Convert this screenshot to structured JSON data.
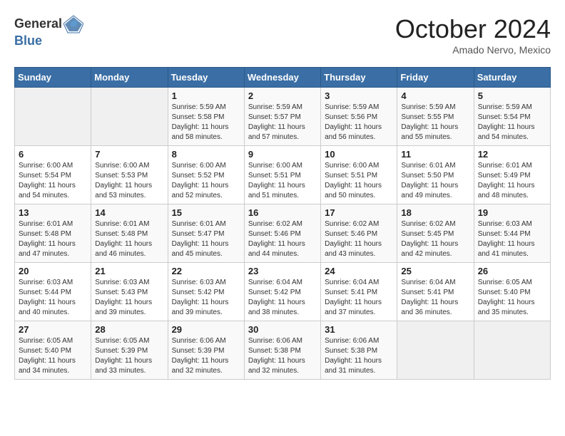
{
  "logo": {
    "general": "General",
    "blue": "Blue"
  },
  "title": "October 2024",
  "location": "Amado Nervo, Mexico",
  "days_of_week": [
    "Sunday",
    "Monday",
    "Tuesday",
    "Wednesday",
    "Thursday",
    "Friday",
    "Saturday"
  ],
  "weeks": [
    [
      {
        "day": "",
        "info": ""
      },
      {
        "day": "",
        "info": ""
      },
      {
        "day": "1",
        "info": "Sunrise: 5:59 AM\nSunset: 5:58 PM\nDaylight: 11 hours and 58 minutes."
      },
      {
        "day": "2",
        "info": "Sunrise: 5:59 AM\nSunset: 5:57 PM\nDaylight: 11 hours and 57 minutes."
      },
      {
        "day": "3",
        "info": "Sunrise: 5:59 AM\nSunset: 5:56 PM\nDaylight: 11 hours and 56 minutes."
      },
      {
        "day": "4",
        "info": "Sunrise: 5:59 AM\nSunset: 5:55 PM\nDaylight: 11 hours and 55 minutes."
      },
      {
        "day": "5",
        "info": "Sunrise: 5:59 AM\nSunset: 5:54 PM\nDaylight: 11 hours and 54 minutes."
      }
    ],
    [
      {
        "day": "6",
        "info": "Sunrise: 6:00 AM\nSunset: 5:54 PM\nDaylight: 11 hours and 54 minutes."
      },
      {
        "day": "7",
        "info": "Sunrise: 6:00 AM\nSunset: 5:53 PM\nDaylight: 11 hours and 53 minutes."
      },
      {
        "day": "8",
        "info": "Sunrise: 6:00 AM\nSunset: 5:52 PM\nDaylight: 11 hours and 52 minutes."
      },
      {
        "day": "9",
        "info": "Sunrise: 6:00 AM\nSunset: 5:51 PM\nDaylight: 11 hours and 51 minutes."
      },
      {
        "day": "10",
        "info": "Sunrise: 6:00 AM\nSunset: 5:51 PM\nDaylight: 11 hours and 50 minutes."
      },
      {
        "day": "11",
        "info": "Sunrise: 6:01 AM\nSunset: 5:50 PM\nDaylight: 11 hours and 49 minutes."
      },
      {
        "day": "12",
        "info": "Sunrise: 6:01 AM\nSunset: 5:49 PM\nDaylight: 11 hours and 48 minutes."
      }
    ],
    [
      {
        "day": "13",
        "info": "Sunrise: 6:01 AM\nSunset: 5:48 PM\nDaylight: 11 hours and 47 minutes."
      },
      {
        "day": "14",
        "info": "Sunrise: 6:01 AM\nSunset: 5:48 PM\nDaylight: 11 hours and 46 minutes."
      },
      {
        "day": "15",
        "info": "Sunrise: 6:01 AM\nSunset: 5:47 PM\nDaylight: 11 hours and 45 minutes."
      },
      {
        "day": "16",
        "info": "Sunrise: 6:02 AM\nSunset: 5:46 PM\nDaylight: 11 hours and 44 minutes."
      },
      {
        "day": "17",
        "info": "Sunrise: 6:02 AM\nSunset: 5:46 PM\nDaylight: 11 hours and 43 minutes."
      },
      {
        "day": "18",
        "info": "Sunrise: 6:02 AM\nSunset: 5:45 PM\nDaylight: 11 hours and 42 minutes."
      },
      {
        "day": "19",
        "info": "Sunrise: 6:03 AM\nSunset: 5:44 PM\nDaylight: 11 hours and 41 minutes."
      }
    ],
    [
      {
        "day": "20",
        "info": "Sunrise: 6:03 AM\nSunset: 5:44 PM\nDaylight: 11 hours and 40 minutes."
      },
      {
        "day": "21",
        "info": "Sunrise: 6:03 AM\nSunset: 5:43 PM\nDaylight: 11 hours and 39 minutes."
      },
      {
        "day": "22",
        "info": "Sunrise: 6:03 AM\nSunset: 5:42 PM\nDaylight: 11 hours and 39 minutes."
      },
      {
        "day": "23",
        "info": "Sunrise: 6:04 AM\nSunset: 5:42 PM\nDaylight: 11 hours and 38 minutes."
      },
      {
        "day": "24",
        "info": "Sunrise: 6:04 AM\nSunset: 5:41 PM\nDaylight: 11 hours and 37 minutes."
      },
      {
        "day": "25",
        "info": "Sunrise: 6:04 AM\nSunset: 5:41 PM\nDaylight: 11 hours and 36 minutes."
      },
      {
        "day": "26",
        "info": "Sunrise: 6:05 AM\nSunset: 5:40 PM\nDaylight: 11 hours and 35 minutes."
      }
    ],
    [
      {
        "day": "27",
        "info": "Sunrise: 6:05 AM\nSunset: 5:40 PM\nDaylight: 11 hours and 34 minutes."
      },
      {
        "day": "28",
        "info": "Sunrise: 6:05 AM\nSunset: 5:39 PM\nDaylight: 11 hours and 33 minutes."
      },
      {
        "day": "29",
        "info": "Sunrise: 6:06 AM\nSunset: 5:39 PM\nDaylight: 11 hours and 32 minutes."
      },
      {
        "day": "30",
        "info": "Sunrise: 6:06 AM\nSunset: 5:38 PM\nDaylight: 11 hours and 32 minutes."
      },
      {
        "day": "31",
        "info": "Sunrise: 6:06 AM\nSunset: 5:38 PM\nDaylight: 11 hours and 31 minutes."
      },
      {
        "day": "",
        "info": ""
      },
      {
        "day": "",
        "info": ""
      }
    ]
  ]
}
